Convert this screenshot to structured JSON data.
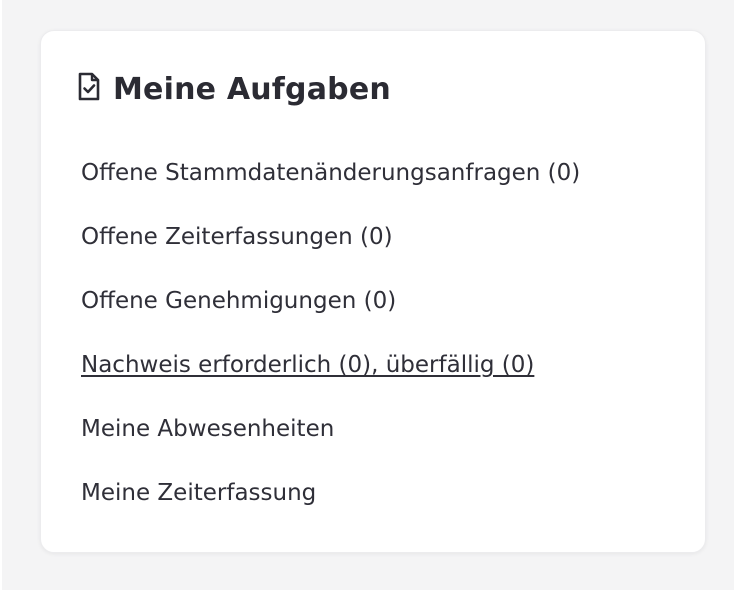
{
  "card": {
    "title": "Meine Aufgaben",
    "icon": "document-check-icon",
    "items": [
      {
        "label": "Offene Stammdatenänderungsanfragen (0)",
        "link": false
      },
      {
        "label": "Offene Zeiterfassungen (0)",
        "link": false
      },
      {
        "label": "Offene Genehmigungen (0)",
        "link": false
      },
      {
        "label": "Nachweis erforderlich (0), überfällig (0)",
        "link": true
      },
      {
        "label": "Meine Abwesenheiten",
        "link": false
      },
      {
        "label": "Meine Zeiterfassung",
        "link": false
      }
    ]
  },
  "colors": {
    "text": "#2f2f38",
    "title": "#2b2b33",
    "card_background": "#ffffff",
    "page_background": "#f4f4f5"
  }
}
